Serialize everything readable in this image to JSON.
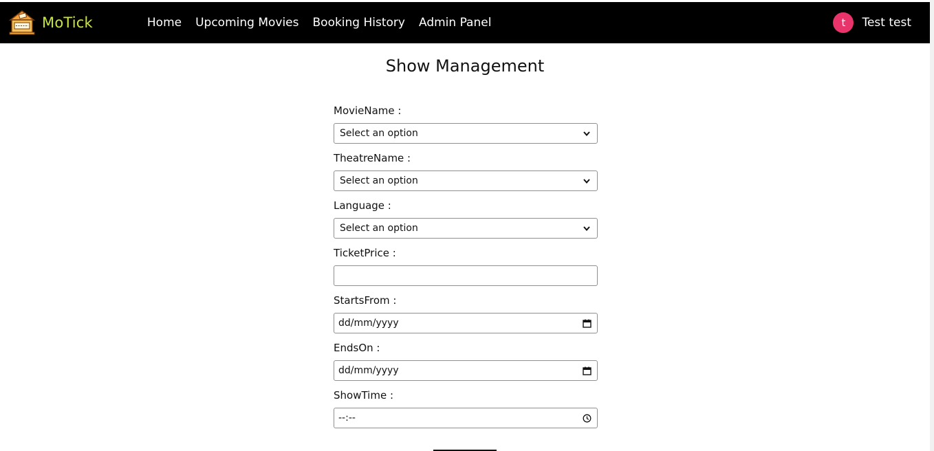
{
  "brand": {
    "name": "MoTick",
    "logo_icon": "ticket-house-logo-icon",
    "accent_color": "#c8e63a"
  },
  "nav": {
    "links": [
      {
        "label": "Home"
      },
      {
        "label": "Upcoming Movies"
      },
      {
        "label": "Booking History"
      },
      {
        "label": "Admin Panel"
      }
    ]
  },
  "user": {
    "avatar_initial": "t",
    "avatar_color": "#e8336b",
    "name": "Test test"
  },
  "page": {
    "title": "Show Management"
  },
  "form": {
    "fields": [
      {
        "label": "MovieName :",
        "type": "select",
        "value": "Select an option",
        "icon": "chevron-down-icon"
      },
      {
        "label": "TheatreName :",
        "type": "select",
        "value": "Select an option",
        "icon": "chevron-down-icon"
      },
      {
        "label": "Language :",
        "type": "select",
        "value": "Select an option",
        "icon": "chevron-down-icon"
      },
      {
        "label": "TicketPrice :",
        "type": "text",
        "value": ""
      },
      {
        "label": "StartsFrom :",
        "type": "date",
        "value": "dd/mm/yyyy",
        "icon": "calendar-icon"
      },
      {
        "label": "EndsOn :",
        "type": "date",
        "value": "dd/mm/yyyy",
        "icon": "calendar-icon"
      },
      {
        "label": "ShowTime :",
        "type": "time",
        "value": "--:--",
        "icon": "clock-icon"
      }
    ]
  }
}
